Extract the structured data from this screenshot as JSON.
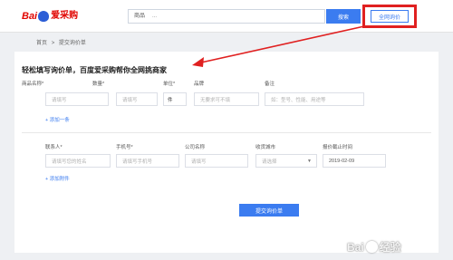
{
  "header": {
    "logo_prefix": "Bai",
    "logo_suffix": "爱采购",
    "search_category": "商品",
    "search_placeholder": "...",
    "search_button": "搜索",
    "all_inquiry_button": "全网询价"
  },
  "breadcrumb": {
    "home": "首页",
    "separator": ">",
    "current": "提交询价单"
  },
  "form": {
    "heading": "轻松填写询价单，百度爱采购帮你全网挑商家",
    "product_labels": {
      "name": "商品名称*",
      "quantity": "数量*",
      "unit": "单位*",
      "brand": "品牌",
      "remark": "备注"
    },
    "product_values": {
      "name_placeholder": "请填写",
      "quantity_placeholder": "请填写",
      "unit_value": "件",
      "brand_placeholder": "无要求可不填",
      "remark_placeholder": "如：型号、性能、用途等"
    },
    "add_row_link": "+ 添加一条",
    "contact_labels": {
      "contact": "联系人*",
      "phone": "手机号*",
      "company": "公司名称",
      "city": "收货城市",
      "deadline": "报价截止时间"
    },
    "contact_values": {
      "contact_placeholder": "请填写您的姓名",
      "phone_placeholder": "请填写手机号",
      "company_placeholder": "请填写",
      "city_placeholder": "请选择",
      "deadline_value": "2019-02-09"
    },
    "add_attachment_link": "+ 添加附件",
    "submit_button": "提交询价单"
  },
  "watermark": {
    "text_left": "Bai",
    "text_right": "经验"
  },
  "colors": {
    "accent": "#3b7cf0",
    "highlight": "#e02020",
    "brand_red": "#e10602"
  }
}
